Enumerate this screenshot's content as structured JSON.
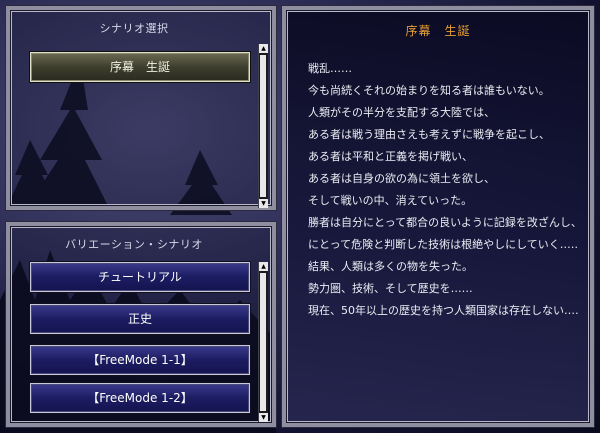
{
  "scenario_panel": {
    "title": "シナリオ選択",
    "items": [
      {
        "label": "序幕　生誕",
        "selected": true
      }
    ]
  },
  "variation_panel": {
    "title": "バリエーション・シナリオ",
    "items": [
      {
        "label": "チュートリアル"
      },
      {
        "label": "正史"
      },
      {
        "label": "【FreeMode 1-1】"
      },
      {
        "label": "【FreeMode 1-2】"
      }
    ]
  },
  "story_panel": {
    "title": "序幕　生誕",
    "lines": [
      "戦乱……",
      "今も尚続くそれの始まりを知る者は誰もいない。",
      "人類がその半分を支配する大陸では、",
      "ある者は戦う理由さえも考えずに戦争を起こし、",
      "ある者は平和と正義を掲げ戦い、",
      "ある者は自身の欲の為に領土を欲し、",
      "そして戦いの中、消えていった。",
      "勝者は自分にとって都合の良いように記録を改ざんし、自分",
      "にとって危険と判断した技術は根絶やしにしていく……",
      "結果、人類は多くの物を失った。",
      "勢力圏、技術、そして歴史を……",
      "現在、50年以上の歴史を持つ人類国家は存在しない……"
    ]
  },
  "colors": {
    "story_title": "#e8a030",
    "button_face": "#1c1c62",
    "button_selected_face": "#3e3e2e",
    "panel_border": "#8e8ea0"
  },
  "icons": {
    "scroll_up": "triangle-up",
    "scroll_down": "triangle-down"
  }
}
